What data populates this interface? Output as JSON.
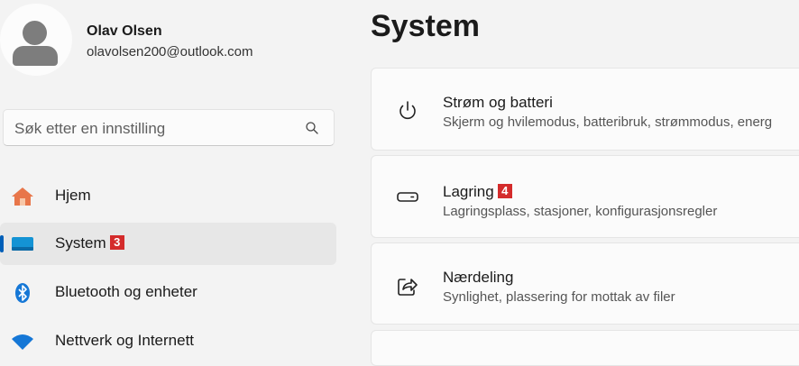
{
  "user": {
    "name": "Olav Olsen",
    "email": "olavolsen200@outlook.com"
  },
  "search": {
    "placeholder": "Søk etter en innstilling"
  },
  "nav": [
    {
      "label": "Hjem",
      "icon": "home-icon"
    },
    {
      "label": "System",
      "icon": "system-icon",
      "badge": "3",
      "active": true
    },
    {
      "label": "Bluetooth og enheter",
      "icon": "bluetooth-icon"
    },
    {
      "label": "Nettverk og Internett",
      "icon": "wifi-icon"
    }
  ],
  "page": {
    "title": "System"
  },
  "cards": [
    {
      "title": "Strøm og batteri",
      "subtitle": "Skjerm og hvilemodus, batteribruk, strømmodus, energ",
      "icon": "power-icon"
    },
    {
      "title": "Lagring",
      "badge": "4",
      "subtitle": "Lagringsplass, stasjoner, konfigurasjonsregler",
      "icon": "storage-icon"
    },
    {
      "title": "Nærdeling",
      "subtitle": "Synlighet, plassering for mottak av filer",
      "icon": "share-icon"
    },
    {
      "title": "",
      "subtitle": "",
      "icon": ""
    }
  ],
  "colors": {
    "accent": "#005fb8",
    "badge": "#d42b2b",
    "background": "#f3f3f3"
  }
}
